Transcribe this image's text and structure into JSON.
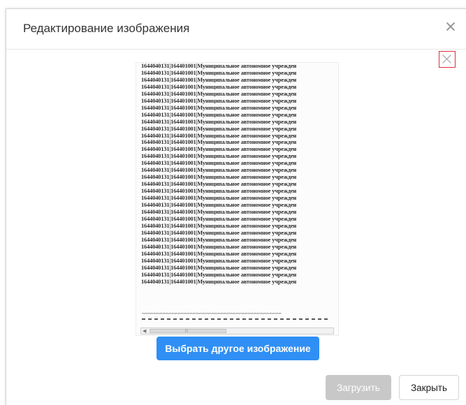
{
  "dialog": {
    "title": "Редактирование изображения",
    "close_icon": "close-icon"
  },
  "preview": {
    "lines": [
      "1644040131|164401001|Муниципальное автономное учрежден",
      "1644040131|164401001|Муниципальное автономное учрежден",
      "1644040131|164401001|Муниципальное автономное учрежден",
      "1644040131|164401001|Муниципальное автономное учрежден",
      "1644040131|164401001|Муниципальное автономное учрежден",
      "1644040131|164401001|Муниципальное автономное учрежден",
      "1644040131|164401001|Муниципальное автономное учрежден",
      "1644040131|164401001|Муниципальное автономное учрежден",
      "1644040131|164401001|Муниципальное автономное учрежден",
      "1644040131|164401001|Муниципальное автономное учрежден",
      "1644040131|164401001|Муниципальное автономное учрежден",
      "1644040131|164401001|Муниципальное автономное учрежден",
      "1644040131|164401001|Муниципальное автономное учрежден",
      "1644040131|164401001|Муниципальное автономное учрежден",
      "1644040131|164401001|Муниципальное автономное учрежден",
      "1644040131|164401001|Муниципальное автономное учрежден",
      "1644040131|164401001|Муниципальное автономное учрежден",
      "1644040131|164401001|Муниципальное автономное учрежден",
      "1644040131|164401001|Муниципальное автономное учрежден",
      "1644040131|164401001|Муниципальное автономное учрежден",
      "1644040131|164401001|Муниципальное автономное учрежден",
      "1644040131|164401001|Муниципальное автономное учрежден",
      "1644040131|164401001|Муниципальное автономное учрежден",
      "1644040131|164401001|Муниципальное автономное учрежден",
      "1644040131|164401001|Муниципальное автономное учрежден",
      "1644040131|164401001|Муниципальное автономное учрежден",
      "1644040131|164401001|Муниципальное автономное учрежден",
      "1644040131|164401001|Муниципальное автономное учрежден",
      "1644040131|164401001|Муниципальное автономное учрежден",
      "1644040131|164401001|Муниципальное автономное учрежден",
      "1644040131|164401001|Муниципальное автономное учрежден",
      "1644040131|164401001|Муниципальное автономное учрежден"
    ],
    "tilde_line": "~~~~~~~~~~~~~~~~~~~~~~~~~~~~~~~~~~~~~~~~~~~~~~~~~~~~~~~~~",
    "remove_icon": "close-icon",
    "remove_border_color": "#d9323a"
  },
  "actions": {
    "choose_label": "Выбрать другое изображение",
    "upload_label": "Загрузить",
    "close_label": "Закрыть"
  },
  "colors": {
    "accent": "#2f8ff5",
    "disabled": "#c8c8c8"
  }
}
